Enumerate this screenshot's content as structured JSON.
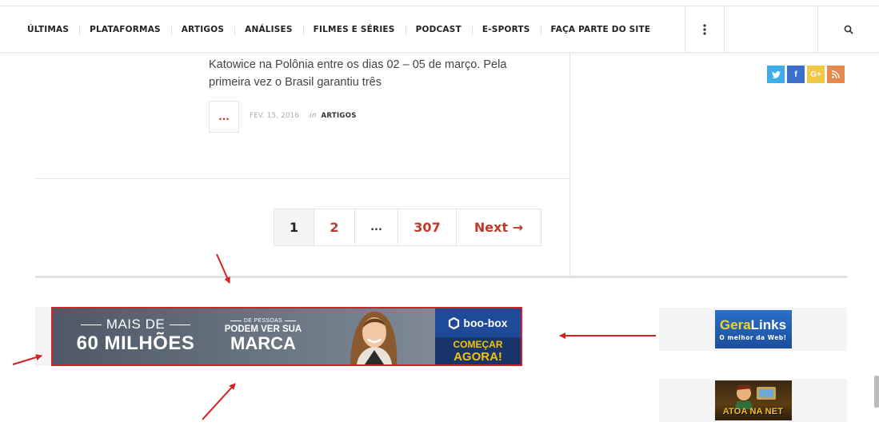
{
  "nav": {
    "items": [
      {
        "label": "ÚLTIMAS"
      },
      {
        "label": "PLATAFORMAS"
      },
      {
        "label": "ARTIGOS"
      },
      {
        "label": "ANÁLISES"
      },
      {
        "label": "FILMES E SÉRIES"
      },
      {
        "label": "PODCAST"
      },
      {
        "label": "E-SPORTS"
      },
      {
        "label": "FAÇA PARTE DO SITE"
      }
    ],
    "more_icon": "vertical-dots-icon",
    "search_icon": "search-icon"
  },
  "article": {
    "excerpt": "Katowice na Polônia entre os dias 02 – 05 de março. Pela primeira vez o Brasil garantiu três",
    "more_label": "...",
    "date": "FEV. 15, 2016",
    "in_label": "in",
    "category": "ARTIGOS"
  },
  "social": [
    {
      "icon": "twitter-icon",
      "glyph": "t",
      "color": "#3daee9"
    },
    {
      "icon": "facebook-icon",
      "glyph": "f",
      "color": "#3b6fc9"
    },
    {
      "icon": "google-plus-icon",
      "glyph": "G+",
      "color": "#f2c744"
    },
    {
      "icon": "rss-icon",
      "glyph": "ʃ",
      "color": "#e58a4f"
    }
  ],
  "pagination": {
    "pages": [
      "1",
      "2",
      "...",
      "307"
    ],
    "current": "1",
    "next_label": "Next →"
  },
  "banner": {
    "line1": "MAIS DE",
    "line2": "60 MILHÕES",
    "small": "DE PESSOAS",
    "mid1": "PODEM VER SUA",
    "mid2": "MARCA",
    "brand": "boo-box",
    "cta1": "COMEÇAR",
    "cta2": "AGORA!"
  },
  "side_ads": {
    "geralinks_a": "Gera",
    "geralinks_b": "Links",
    "geralinks_tagline": "O melhor da Web!",
    "atoa_text": "ATOA NA NET"
  },
  "colors": {
    "accent": "#c0392b",
    "banner_border": "#d0222a",
    "annotation_arrow": "#d42020"
  }
}
